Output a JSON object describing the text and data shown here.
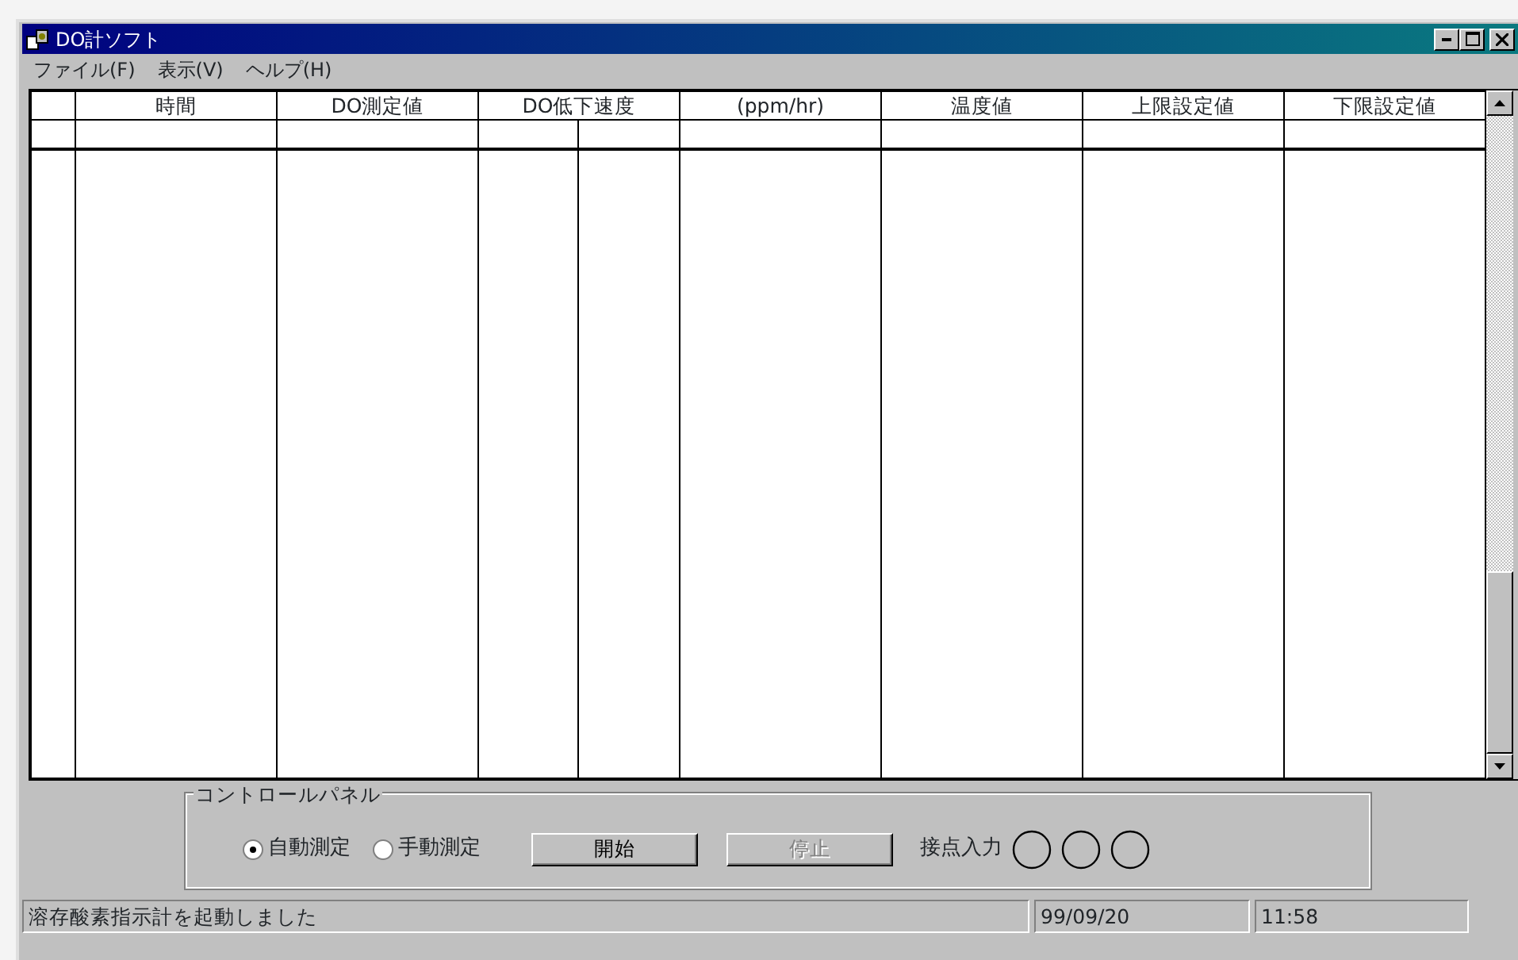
{
  "window": {
    "title": "DO計ソフト"
  },
  "menu": [
    {
      "label": "ファイル(F)"
    },
    {
      "label": "表示(V)"
    },
    {
      "label": "ヘルプ(H)"
    }
  ],
  "table": {
    "columns": [
      {
        "kind": "row_header"
      },
      {
        "label": "時間",
        "kind": "single"
      },
      {
        "label": "DO測定値",
        "kind": "single"
      },
      {
        "label": "DO低下速度",
        "kind": "double"
      },
      {
        "label": "(ppm/hr)",
        "kind": "single"
      },
      {
        "label": "温度値",
        "kind": "single"
      },
      {
        "label": "上限設定値",
        "kind": "single"
      },
      {
        "label": "下限設定値",
        "kind": "single"
      }
    ]
  },
  "control_panel": {
    "title": "コントロールパネル",
    "modes": [
      {
        "label": "自動測定",
        "selected": true
      },
      {
        "label": "手動測定",
        "selected": false
      }
    ],
    "buttons": [
      {
        "label": "開始",
        "disabled": false
      },
      {
        "label": "停止",
        "disabled": true
      }
    ],
    "contact_input": {
      "label": "接点入力",
      "lamps": [
        {
          "on": false
        },
        {
          "on": false
        },
        {
          "on": false
        }
      ]
    }
  },
  "status_bar": {
    "message": "溶存酸素指示計を起動しました",
    "date": "99/09/20",
    "time": "11:58"
  }
}
